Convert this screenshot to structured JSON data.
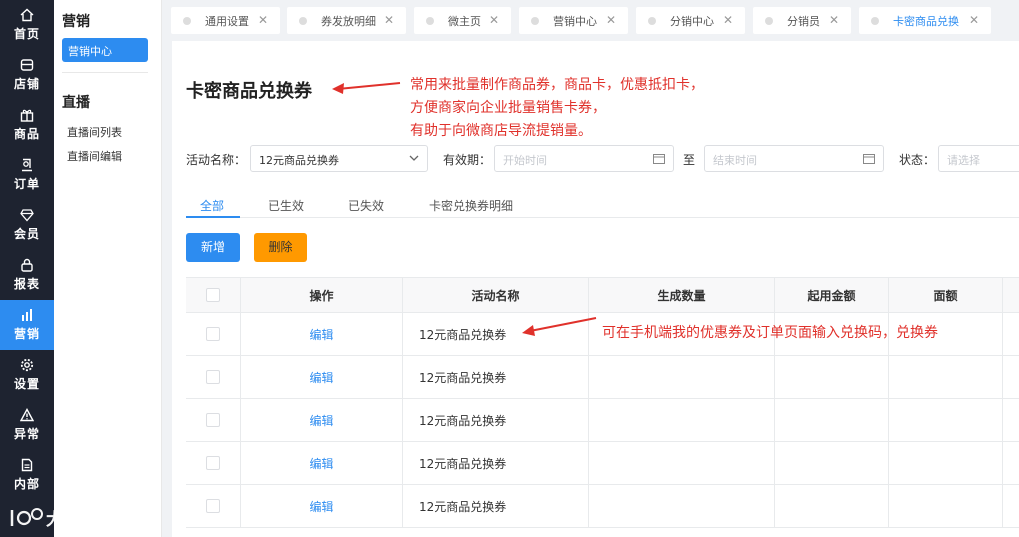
{
  "nav": {
    "items": [
      {
        "label": "首页",
        "icon": "home-icon"
      },
      {
        "label": "店铺",
        "icon": "store-icon"
      },
      {
        "label": "商品",
        "icon": "gift-icon"
      },
      {
        "label": "订单",
        "icon": "order-icon"
      },
      {
        "label": "会员",
        "icon": "diamond-icon"
      },
      {
        "label": "报表",
        "icon": "lock-icon"
      },
      {
        "label": "营销",
        "icon": "bar-chart-icon"
      },
      {
        "label": "设置",
        "icon": "gear-icon"
      },
      {
        "label": "异常",
        "icon": "warning-icon"
      },
      {
        "label": "内部",
        "icon": "document-icon"
      }
    ],
    "active_index": 6,
    "active_color": "#2d8cf0"
  },
  "sub": {
    "section1": "营销",
    "section1_active": "营销中心",
    "section2": "直播",
    "links": [
      "直播间列表",
      "直播间编辑"
    ]
  },
  "tabs": [
    {
      "label": "通用设置"
    },
    {
      "label": "券发放明细"
    },
    {
      "label": "微主页"
    },
    {
      "label": "营销中心"
    },
    {
      "label": "分销中心"
    },
    {
      "label": "分销员"
    },
    {
      "label": "卡密商品兑换"
    }
  ],
  "page": {
    "title": "卡密商品兑换券",
    "annotation_top": [
      "常用来批量制作商品券，商品卡，优惠抵扣卡，",
      "方便商家向企业批量销售卡券，",
      "有助于向微商店导流提销量。"
    ],
    "annotation_row": "可在手机端我的优惠券及订单页面输入兑换码，兑换券",
    "annotation_color": "#e0312b"
  },
  "filters": {
    "name_label": "活动名称：",
    "name_value": "12元商品兑换券",
    "period_label": "有效期：",
    "start_placeholder": "开始时间",
    "to_label": "至",
    "end_placeholder": "结束时间",
    "status_label": "状态：",
    "status_placeholder": "请选择"
  },
  "status_tabs": [
    "全部",
    "已生效",
    "已失效",
    "卡密兑换券明细"
  ],
  "buttons": {
    "add": "新增",
    "delete": "删除"
  },
  "table": {
    "columns": [
      "操作",
      "活动名称",
      "生成数量",
      "起用金额",
      "面额"
    ],
    "rows": [
      {
        "action": "编辑",
        "name": "12元商品兑换券"
      },
      {
        "action": "编辑",
        "name": "12元商品兑换券"
      },
      {
        "action": "编辑",
        "name": "12元商品兑换券"
      },
      {
        "action": "编辑",
        "name": "12元商品兑换券"
      },
      {
        "action": "编辑",
        "name": "12元商品兑换券"
      }
    ]
  },
  "watermark": "大数跨境"
}
